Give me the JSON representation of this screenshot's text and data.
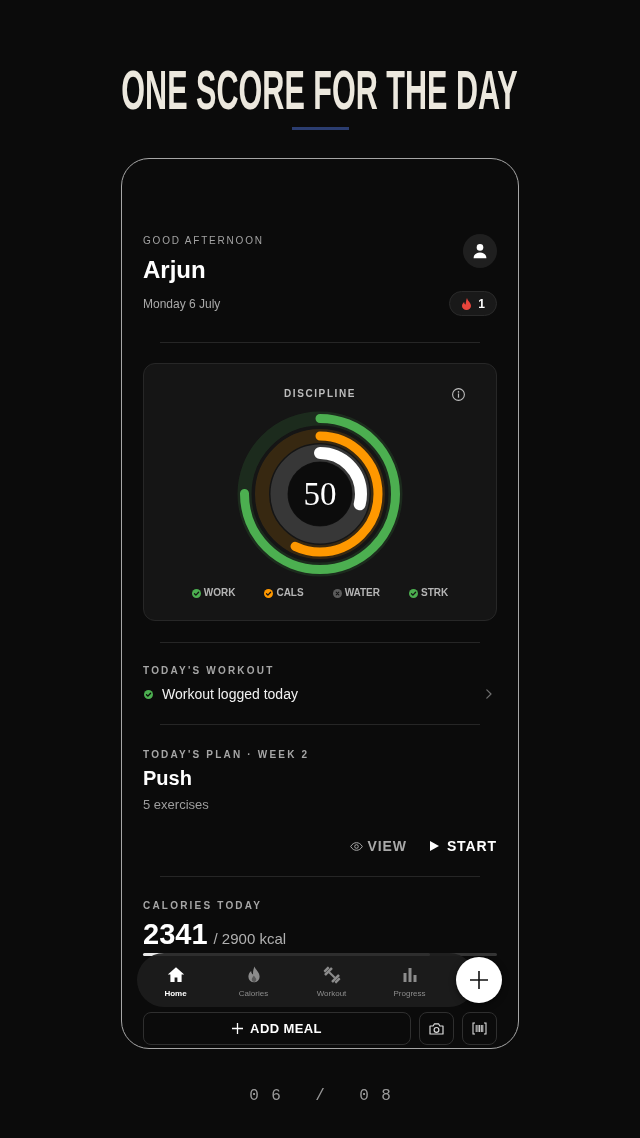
{
  "headline": {
    "title": "ONE SCORE FOR THE DAY"
  },
  "header": {
    "greeting": "GOOD AFTERNOON",
    "name": "Arjun",
    "date": "Monday 6 July",
    "streak": "1"
  },
  "discipline": {
    "title": "DISCIPLINE",
    "score": "50",
    "rings": [
      {
        "level": 0.75,
        "color": "#4caf50"
      },
      {
        "level": 0.57,
        "color": "#ff9800"
      },
      {
        "level": 0.29,
        "color": "#ffffff"
      }
    ],
    "legend": [
      {
        "label": "WORK",
        "done": true,
        "color": "#4caf50"
      },
      {
        "label": "CALS",
        "done": true,
        "color": "#ff9800"
      },
      {
        "label": "WATER",
        "done": false,
        "color": "#5c5c5c"
      },
      {
        "label": "STRK",
        "done": true,
        "color": "#4caf50"
      }
    ]
  },
  "workout": {
    "title": "TODAY'S WORKOUT",
    "status": "Workout logged today",
    "done": true
  },
  "plan": {
    "title": "TODAY'S PLAN · WEEK 2",
    "name": "Push",
    "detail": "5 exercises",
    "actions": [
      {
        "label": "VIEW",
        "kind": "secondary"
      },
      {
        "label": "START",
        "kind": "primary"
      }
    ]
  },
  "calories": {
    "title": "CALORIES TODAY",
    "value": "2341",
    "goal": "/ 2900 kcal",
    "level": 0.81,
    "add_button": "ADD MEAL"
  },
  "nav": {
    "items": [
      {
        "label": "Home",
        "selected": true
      },
      {
        "label": "Calories",
        "selected": false
      },
      {
        "label": "Workout",
        "selected": false
      },
      {
        "label": "Progress",
        "selected": false
      }
    ]
  },
  "page_counter": "06 / 08"
}
